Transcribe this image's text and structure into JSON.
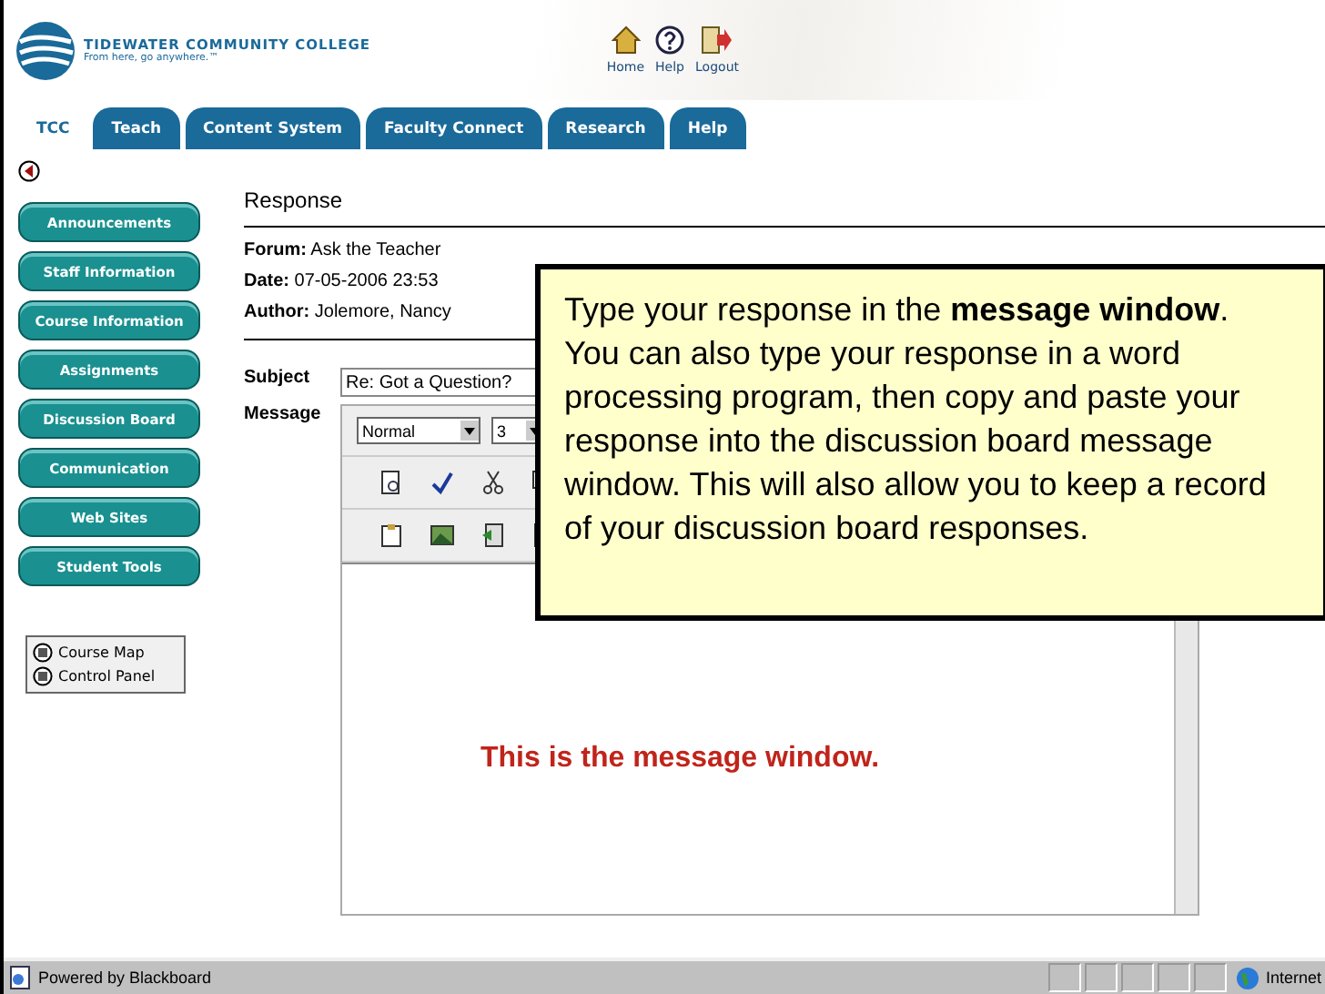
{
  "header": {
    "college_name": "TIDEWATER COMMUNITY COLLEGE",
    "tagline": "From here, go anywhere.™",
    "links": [
      {
        "kind": "home",
        "label": "Home"
      },
      {
        "kind": "help",
        "label": "Help"
      },
      {
        "kind": "logout",
        "label": "Logout"
      }
    ]
  },
  "tabs": [
    {
      "label": "TCC",
      "selected": true
    },
    {
      "label": "Teach",
      "selected": false
    },
    {
      "label": "Content System",
      "selected": false
    },
    {
      "label": "Faculty Connect",
      "selected": false
    },
    {
      "label": "Research",
      "selected": false
    },
    {
      "label": "Help",
      "selected": false
    }
  ],
  "sidebar": {
    "buttons": [
      "Announcements",
      "Staff Information",
      "Course Information",
      "Assignments",
      "Discussion Board",
      "Communication",
      "Web Sites",
      "Student Tools"
    ],
    "tools": [
      "Course Map",
      "Control Panel"
    ]
  },
  "response": {
    "title": "Response",
    "fields": [
      {
        "label": "Forum:",
        "value": "Ask the Teacher"
      },
      {
        "label": "Date:",
        "value": "07-05-2006 23:53"
      },
      {
        "label": "Author:",
        "value": "Jolemore, Nancy"
      }
    ],
    "subject": {
      "label": "Subject",
      "value": "Re: Got a Question?"
    },
    "message": {
      "label": "Message",
      "style": "Normal",
      "size": "3"
    },
    "annotation": "This is the message window."
  },
  "callout": {
    "text": "Type your response in the **message window**. You can also type your response in a word processing program, then copy and paste your response into the discussion board message window. This will also allow you to keep a record of your discussion board responses."
  },
  "status_bar": {
    "left": "Powered by Blackboard",
    "zone": "Internet"
  }
}
